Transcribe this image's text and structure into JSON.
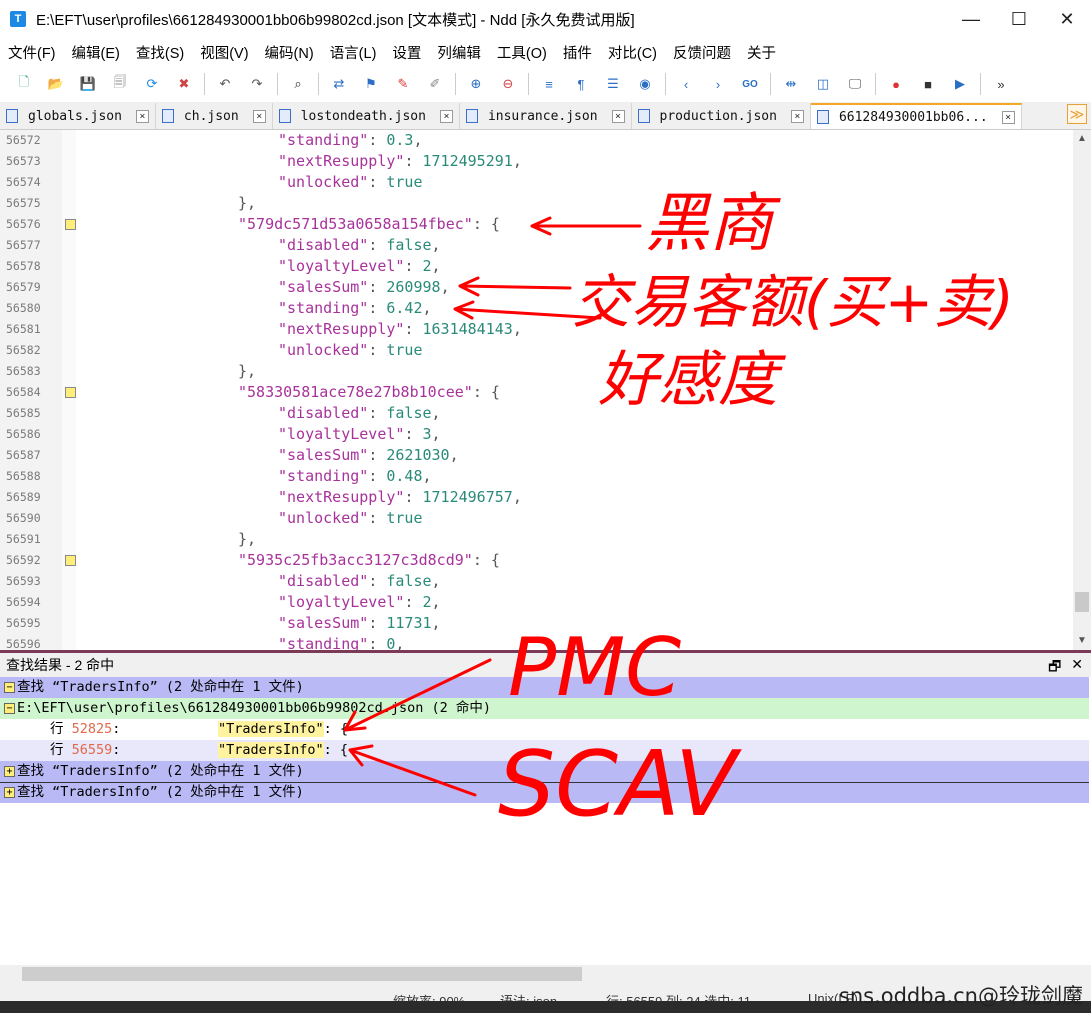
{
  "window": {
    "title": "E:\\EFT\\user\\profiles\\661284930001bb06b99802cd.json [文本模式] - Ndd [永久免费试用版]",
    "icon_label": "T",
    "minimize": "—",
    "maximize": "☐",
    "close": "✕"
  },
  "menu": [
    "文件(F)",
    "编辑(E)",
    "查找(S)",
    "视图(V)",
    "编码(N)",
    "语言(L)",
    "设置",
    "列编辑",
    "工具(O)",
    "插件",
    "对比(C)",
    "反馈问题",
    "关于"
  ],
  "toolbar": [
    {
      "icon": "new-file-icon",
      "glyph": "🗋",
      "color": "#4a8"
    },
    {
      "icon": "open-file-icon",
      "glyph": "📂",
      "color": "#d9a520"
    },
    {
      "icon": "save-icon",
      "glyph": "💾",
      "color": "#888"
    },
    {
      "icon": "save-all-icon",
      "glyph": "🗐",
      "color": "#888"
    },
    {
      "icon": "reload-icon",
      "glyph": "⟳",
      "color": "#1e88e5"
    },
    {
      "icon": "close-file-icon",
      "glyph": "✖",
      "color": "#c44"
    },
    {
      "icon": "undo-icon",
      "glyph": "↶",
      "color": "#555"
    },
    {
      "icon": "redo-icon",
      "glyph": "↷",
      "color": "#555"
    },
    {
      "icon": "find-icon",
      "glyph": "⌕",
      "color": "#333"
    },
    {
      "icon": "replace-icon",
      "glyph": "⇄",
      "color": "#2a6fc4"
    },
    {
      "icon": "bookmark-icon",
      "glyph": "⚑",
      "color": "#2a6fc4"
    },
    {
      "icon": "marker-icon",
      "glyph": "✎",
      "color": "#d33"
    },
    {
      "icon": "clear-mark-icon",
      "glyph": "✐",
      "color": "#888"
    },
    {
      "icon": "zoom-in-icon",
      "glyph": "⊕",
      "color": "#2a6fc4"
    },
    {
      "icon": "zoom-out-icon",
      "glyph": "⊖",
      "color": "#c44"
    },
    {
      "icon": "wrap-icon",
      "glyph": "≡",
      "color": "#2a6fc4"
    },
    {
      "icon": "show-symbols-icon",
      "glyph": "¶",
      "color": "#2a6fc4"
    },
    {
      "icon": "indent-guide-icon",
      "glyph": "☰",
      "color": "#2a6fc4"
    },
    {
      "icon": "record-icon",
      "glyph": "◉",
      "color": "#2a6fc4"
    },
    {
      "icon": "prev-icon",
      "glyph": "‹",
      "color": "#2a6fc4"
    },
    {
      "icon": "next-icon",
      "glyph": "›",
      "color": "#2a6fc4"
    },
    {
      "icon": "goto-icon",
      "glyph": "GO",
      "color": "#2a6fc4"
    },
    {
      "icon": "compare-icon",
      "glyph": "⇹",
      "color": "#2a6fc4"
    },
    {
      "icon": "split-view-icon",
      "glyph": "◫",
      "color": "#2a6fc4"
    },
    {
      "icon": "monitor-icon",
      "glyph": "🖵",
      "color": "#555"
    },
    {
      "icon": "macro-record-icon",
      "glyph": "●",
      "color": "#d33"
    },
    {
      "icon": "macro-stop-icon",
      "glyph": "■",
      "color": "#333"
    },
    {
      "icon": "macro-play-icon",
      "glyph": "▶",
      "color": "#2a6fc4"
    },
    {
      "icon": "overflow-icon",
      "glyph": "»",
      "color": "#333"
    }
  ],
  "tabs": [
    {
      "label": "globals.json",
      "active": false
    },
    {
      "label": "ch.json",
      "active": false
    },
    {
      "label": "lostondeath.json",
      "active": false
    },
    {
      "label": "insurance.json",
      "active": false
    },
    {
      "label": "production.json",
      "active": false
    },
    {
      "label": "661284930001bb06...",
      "active": true
    }
  ],
  "tab_dropdown": "≫",
  "editor": {
    "lines": [
      {
        "no": "56572",
        "indent": 10,
        "key": "\"standing\"",
        "val": "0.3",
        "vtype": "n",
        "trail": ","
      },
      {
        "no": "56573",
        "indent": 10,
        "key": "\"nextResupply\"",
        "val": "1712495291",
        "vtype": "n",
        "trail": ","
      },
      {
        "no": "56574",
        "indent": 10,
        "key": "\"unlocked\"",
        "val": "true",
        "vtype": "b",
        "trail": ""
      },
      {
        "no": "56575",
        "indent": 8,
        "raw": "},"
      },
      {
        "no": "56576",
        "indent": 8,
        "key": "\"579dc571d53a0658a154fbec\"",
        "val": "{",
        "vtype": "p",
        "trail": "",
        "fold": true
      },
      {
        "no": "56577",
        "indent": 10,
        "key": "\"disabled\"",
        "val": "false",
        "vtype": "b",
        "trail": ","
      },
      {
        "no": "56578",
        "indent": 10,
        "key": "\"loyaltyLevel\"",
        "val": "2",
        "vtype": "n",
        "trail": ","
      },
      {
        "no": "56579",
        "indent": 10,
        "key": "\"salesSum\"",
        "val": "260998",
        "vtype": "n",
        "trail": ","
      },
      {
        "no": "56580",
        "indent": 10,
        "key": "\"standing\"",
        "val": "6.42",
        "vtype": "n",
        "trail": ","
      },
      {
        "no": "56581",
        "indent": 10,
        "key": "\"nextResupply\"",
        "val": "1631484143",
        "vtype": "n",
        "trail": ","
      },
      {
        "no": "56582",
        "indent": 10,
        "key": "\"unlocked\"",
        "val": "true",
        "vtype": "b",
        "trail": ""
      },
      {
        "no": "56583",
        "indent": 8,
        "raw": "},"
      },
      {
        "no": "56584",
        "indent": 8,
        "key": "\"58330581ace78e27b8b10cee\"",
        "val": "{",
        "vtype": "p",
        "trail": "",
        "fold": true
      },
      {
        "no": "56585",
        "indent": 10,
        "key": "\"disabled\"",
        "val": "false",
        "vtype": "b",
        "trail": ","
      },
      {
        "no": "56586",
        "indent": 10,
        "key": "\"loyaltyLevel\"",
        "val": "3",
        "vtype": "n",
        "trail": ","
      },
      {
        "no": "56587",
        "indent": 10,
        "key": "\"salesSum\"",
        "val": "2621030",
        "vtype": "n",
        "trail": ","
      },
      {
        "no": "56588",
        "indent": 10,
        "key": "\"standing\"",
        "val": "0.48",
        "vtype": "n",
        "trail": ","
      },
      {
        "no": "56589",
        "indent": 10,
        "key": "\"nextResupply\"",
        "val": "1712496757",
        "vtype": "n",
        "trail": ","
      },
      {
        "no": "56590",
        "indent": 10,
        "key": "\"unlocked\"",
        "val": "true",
        "vtype": "b",
        "trail": ""
      },
      {
        "no": "56591",
        "indent": 8,
        "raw": "},"
      },
      {
        "no": "56592",
        "indent": 8,
        "key": "\"5935c25fb3acc3127c3d8cd9\"",
        "val": "{",
        "vtype": "p",
        "trail": "",
        "fold": true
      },
      {
        "no": "56593",
        "indent": 10,
        "key": "\"disabled\"",
        "val": "false",
        "vtype": "b",
        "trail": ","
      },
      {
        "no": "56594",
        "indent": 10,
        "key": "\"loyaltyLevel\"",
        "val": "2",
        "vtype": "n",
        "trail": ","
      },
      {
        "no": "56595",
        "indent": 10,
        "key": "\"salesSum\"",
        "val": "11731",
        "vtype": "n",
        "trail": ","
      },
      {
        "no": "56596",
        "indent": 10,
        "key": "\"standing\"",
        "val": "0",
        "vtype": "n",
        "trail": ","
      }
    ]
  },
  "find": {
    "header": "查找结果 - 2 命中",
    "restore_icon": "🗗",
    "close_icon": "✕",
    "rows": [
      {
        "type": "search",
        "box": "−",
        "text": "查找 “TradersInfo” (2 处命中在 1 文件)"
      },
      {
        "type": "file",
        "box": "−",
        "text": "E:\\EFT\\user\\profiles\\661284930001bb06b99802cd.json (2 命中)"
      },
      {
        "type": "hit",
        "prefix": "行 ",
        "line": "52825",
        "sep": ":",
        "pad": "            ",
        "tag": "\"TradersInfo\"",
        "tail": ": {"
      },
      {
        "type": "hit-alt",
        "prefix": "行 ",
        "line": "56559",
        "sep": ":",
        "pad": "            ",
        "tag": "\"TradersInfo\"",
        "tail": ": {"
      },
      {
        "type": "search",
        "box": "+",
        "text": "查找 “TradersInfo” (2 处命中在 1 文件)"
      },
      {
        "type": "search",
        "box": "+",
        "text": "查找 “TradersInfo” (2 处命中在 1 文件)"
      }
    ]
  },
  "status": {
    "zoom": "缩放率: 90%",
    "lang": "语法: json",
    "position": "行: 56559 列: 24 选中: 11",
    "encoding": "Unix(LF)"
  },
  "watermark": "sns.oddba.cn@玲珑剑魔",
  "annotations": {
    "color": "#ff0000",
    "texts": [
      "黑商",
      "交易客额(买+卖)",
      "好感度",
      "PMC",
      "SCAV"
    ]
  }
}
